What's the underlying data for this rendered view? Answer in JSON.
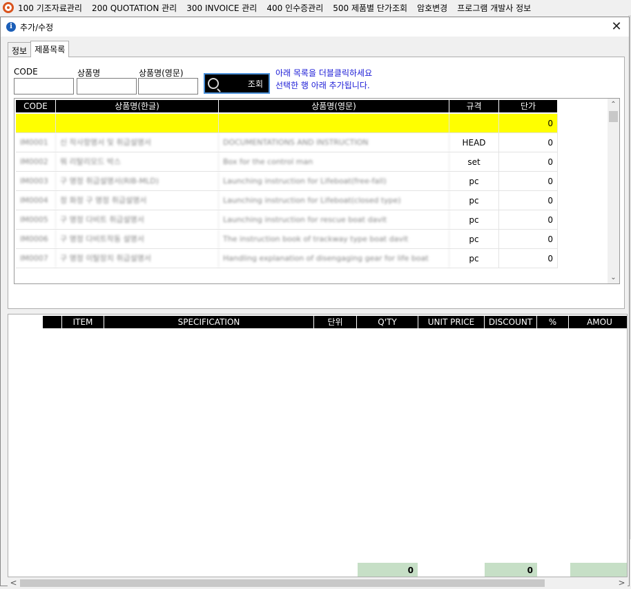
{
  "menubar": {
    "items": [
      "100 기조자료관리",
      "200 QUOTATION 관리",
      "300 INVOICE 관리",
      "400 인수증관리",
      "500 제품별 단가조회",
      "암호변경",
      "프로그램 개발사 정보"
    ]
  },
  "dialog": {
    "title": "추가/수정",
    "close": "✕"
  },
  "tabs": [
    {
      "label": "정보"
    },
    {
      "label": "제품목록"
    }
  ],
  "search": {
    "code_label": "CODE",
    "name_kr_label": "상품명",
    "name_en_label": "상품명(영문)",
    "code_value": "",
    "name_kr_value": "",
    "name_en_value": "",
    "button_label": "조회",
    "hint_line1": "아래 목록을 더블클릭하세요",
    "hint_line2": "선택한 행 아래 추가됩니다."
  },
  "product_grid": {
    "columns": [
      "CODE",
      "상품명(한글)",
      "상품명(영문)",
      "규격",
      "단가"
    ],
    "rows": [
      {
        "code": "",
        "name_kr": "",
        "name_en": "",
        "spec": "",
        "price": "0",
        "selected": true
      },
      {
        "code": "IM0001",
        "name_kr": "신 작사항명서 및 취급설명서",
        "name_en": "DOCUMENTATIONS AND INSTRUCTION",
        "spec": "HEAD",
        "price": "0"
      },
      {
        "code": "IM0002",
        "name_kr": "뭐 리탈리모드 박스",
        "name_en": "Box for the control man",
        "spec": "set",
        "price": "0"
      },
      {
        "code": "IM0003",
        "name_kr": "구 명정 취급설명서(RIB-MLD)",
        "name_en": "Launching instruction for Lifeboat(free-fall)",
        "spec": "pc",
        "price": "0"
      },
      {
        "code": "IM0004",
        "name_kr": "정 화정 구 명정 취급설명서",
        "name_en": "Launching instruction for Lifeboat(closed type)",
        "spec": "pc",
        "price": "0"
      },
      {
        "code": "IM0005",
        "name_kr": "구 명정 다비트 취급설명서",
        "name_en": "Launching instruction for rescue boat davit",
        "spec": "pc",
        "price": "0"
      },
      {
        "code": "IM0006",
        "name_kr": "구 명정 다비트작동 설명서",
        "name_en": "The instruction book of trackway type boat davit",
        "spec": "pc",
        "price": "0"
      },
      {
        "code": "IM0007",
        "name_kr": "구 명정 이탈장치 취급설명서",
        "name_en": "Handling explanation of disengaging gear for life boat",
        "spec": "pc",
        "price": "0"
      }
    ]
  },
  "invoice_grid": {
    "columns": [
      "",
      "ITEM",
      "SPECIFICATION",
      "단위",
      "Q'TY",
      "UNIT PRICE",
      "DISCOUNT",
      "%",
      "AMOU"
    ],
    "totals": {
      "qty": "0",
      "discount": "0",
      "amount": ""
    }
  },
  "scroll": {
    "up": "⌃",
    "down": "⌄",
    "left": "<",
    "right": ">"
  }
}
